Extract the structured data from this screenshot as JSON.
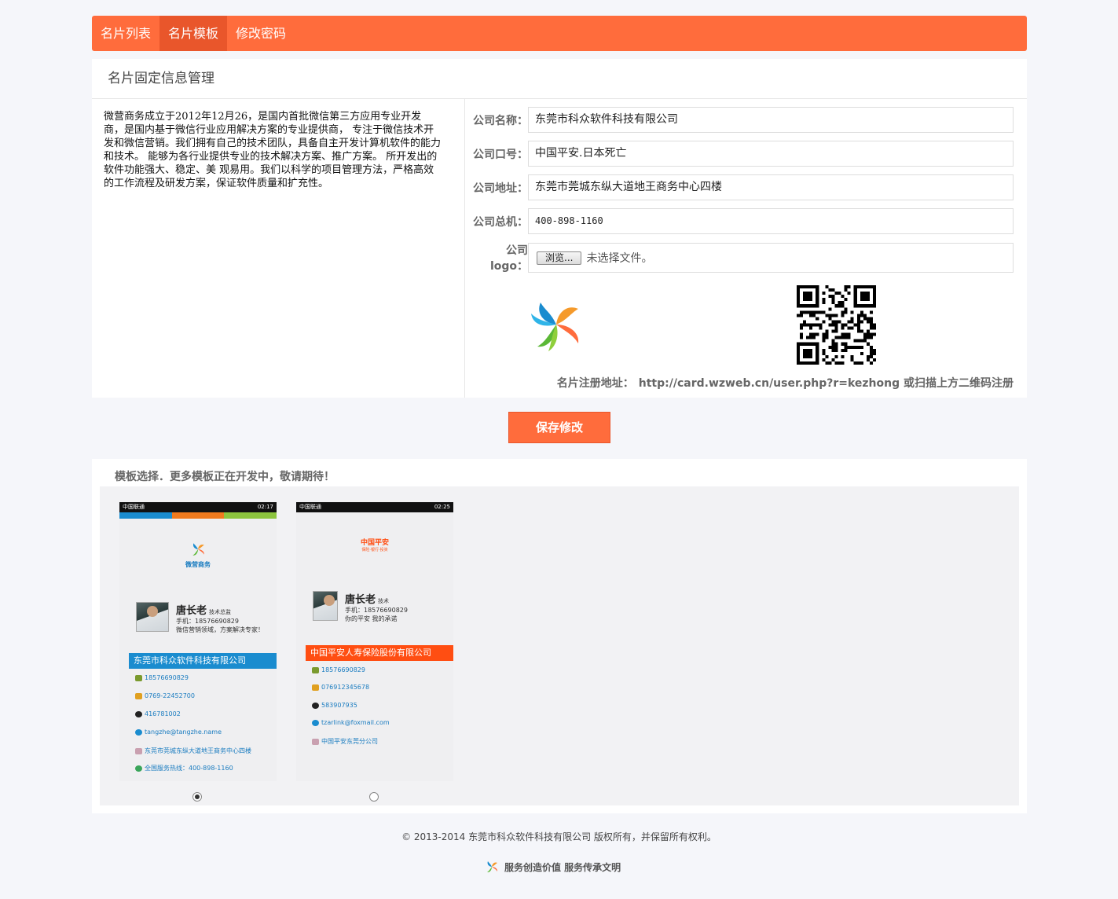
{
  "nav": {
    "tabs": [
      {
        "label": "名片列表",
        "active": false
      },
      {
        "label": "名片模板",
        "active": true
      },
      {
        "label": "修改密码",
        "active": false
      }
    ]
  },
  "panel": {
    "title": "名片固定信息管理",
    "intro": "微营商务成立于2012年12月26，是国内首批微信第三方应用专业开发商，是国内基于微信行业应用解决方案的专业提供商， 专注于微信技术开发和微信营销。我们拥有自己的技术团队，具备自主开发计算机软件的能力和技术。 能够为各行业提供专业的技术解决方案、推广方案。 所开发出的软件功能强大、稳定、美 观易用。我们以科学的项目管理方法，严格高效的工作流程及研发方案，保证软件质量和扩充性。"
  },
  "form": {
    "company_name_label": "公司名称：",
    "company_name_value": "东莞市科众软件科技有限公司",
    "slogan_label": "公司口号：",
    "slogan_value": "中国平安.日本死亡",
    "address_label": "公司地址：",
    "address_value": "东莞市莞城东纵大道地王商务中心四楼",
    "phone_label": "公司总机：",
    "phone_value": "400-898-1160",
    "logo_label": "公司logo：",
    "browse_label": "浏览...",
    "file_status": "未选择文件。"
  },
  "register": {
    "label": "名片注册地址：",
    "url": "http://card.wzweb.cn/user.php?r=kezhong 或扫描上方二维码注册"
  },
  "save_button": "保存修改",
  "templates": {
    "title": "模板选择．更多模板正在开发中，敬请期待！",
    "cards": [
      {
        "status_left": "中国联通",
        "time": "02:17",
        "brand": "微营商务",
        "name": "唐长老",
        "title": "技术总监",
        "mobile": "手机：18576690829",
        "motto": "微信营销领域，方案解决专家！",
        "company": "东莞市科众软件科技有限公司",
        "contacts": [
          "18576690829",
          "0769-22452700",
          "416781002",
          "tangzhe@tangzhe.name",
          "东莞市莞城东纵大道地王商务中心四楼",
          "全国服务热线：400-898-1160"
        ],
        "selected": true
      },
      {
        "status_left": "中国联通",
        "time": "02:25",
        "brand": "中国平安",
        "brand_sub": "保险·银行·投资",
        "name": "唐长老",
        "title": "技术",
        "mobile": "手机：18576690829",
        "motto": "你的平安 我的承诺",
        "company": "中国平安人寿保险股份有限公司",
        "contacts": [
          "18576690829",
          "076912345678",
          "583907935",
          "tzarlink@foxmail.com",
          "中国平安东莞分公司"
        ],
        "selected": false
      }
    ]
  },
  "footer": {
    "copyright": "© 2013-2014 东莞市科众软件科技有限公司 版权所有，并保留所有权利。",
    "slogan": "服务创造价值  服务传承文明"
  },
  "colors": {
    "accent": "#ff6c3c",
    "accent_dark": "#e9562b",
    "blue_bar": "#1a8ccf",
    "orange_bar": "#ff4e12"
  }
}
